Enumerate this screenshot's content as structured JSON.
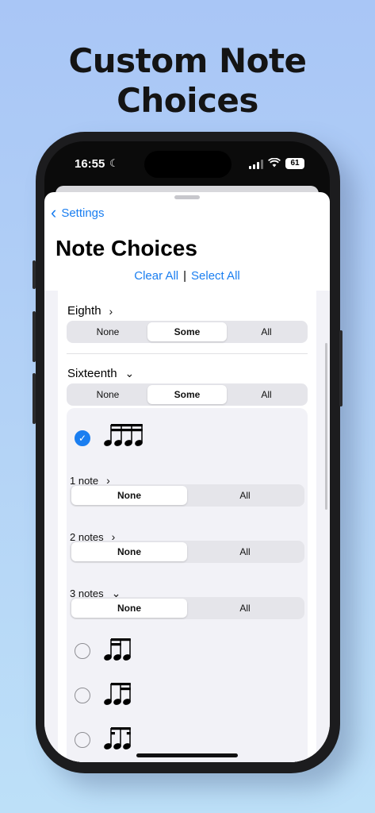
{
  "headline": {
    "line1": "Custom Note",
    "line2": "Choices"
  },
  "status_bar": {
    "time": "16:55",
    "battery": "61",
    "icons": [
      "moon-icon",
      "cellular-signal-icon",
      "wifi-icon",
      "battery-icon"
    ]
  },
  "nav": {
    "back_label": "Settings",
    "title": "Note Choices"
  },
  "actions": {
    "clear_all": "Clear All",
    "separator": "|",
    "select_all": "Select All"
  },
  "sections": [
    {
      "label": "Eighth",
      "expanded": false,
      "options": [
        "None",
        "Some",
        "All"
      ],
      "selected": "Some"
    },
    {
      "label": "Sixteenth",
      "expanded": true,
      "options": [
        "None",
        "Some",
        "All"
      ],
      "selected": "Some"
    }
  ],
  "sixteenth": {
    "all_four_checked": true,
    "groups": [
      {
        "label": "1 note",
        "expanded": false,
        "options": [
          "None",
          "All"
        ],
        "selected": "None"
      },
      {
        "label": "2 notes",
        "expanded": false,
        "options": [
          "None",
          "All"
        ],
        "selected": "None"
      },
      {
        "label": "3 notes",
        "expanded": true,
        "options": [
          "None",
          "All"
        ],
        "selected": "None"
      }
    ],
    "three_note_patterns": [
      {
        "name": "rhythm-pattern-sixteenth-sixteenth-eighth",
        "checked": false
      },
      {
        "name": "rhythm-pattern-eighth-sixteenth-sixteenth",
        "checked": false
      },
      {
        "name": "rhythm-pattern-sixteenth-eighth-sixteenth",
        "checked": false
      }
    ]
  },
  "colors": {
    "accent": "#1a7ef0",
    "background_top": "#a9c6f6",
    "background_bottom": "#bde0f8"
  }
}
